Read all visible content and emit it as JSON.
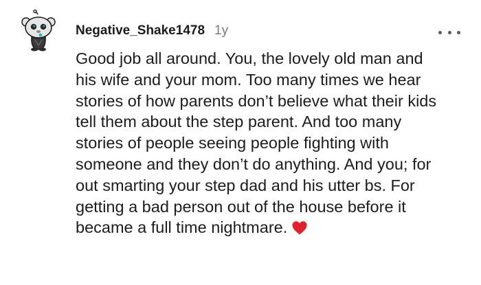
{
  "comment": {
    "username": "Negative_Shake1478",
    "age": "1y",
    "body": "Good job all around. You, the lovely old man and his wife and your mom. Too many times we hear stories of how parents don’t believe what their kids tell them about the step parent. And too many stories of people seeing people fighting with someone and they don’t do anything. And you; for out smarting your step dad and his utter bs. For getting a bad person out of the house before it became a full time nightmare.",
    "emoji": "heart-icon",
    "more_icon": "more-options-icon"
  },
  "colors": {
    "text": "#1c1c1c",
    "meta": "#7c7c7c",
    "heart": "#e0222f"
  }
}
